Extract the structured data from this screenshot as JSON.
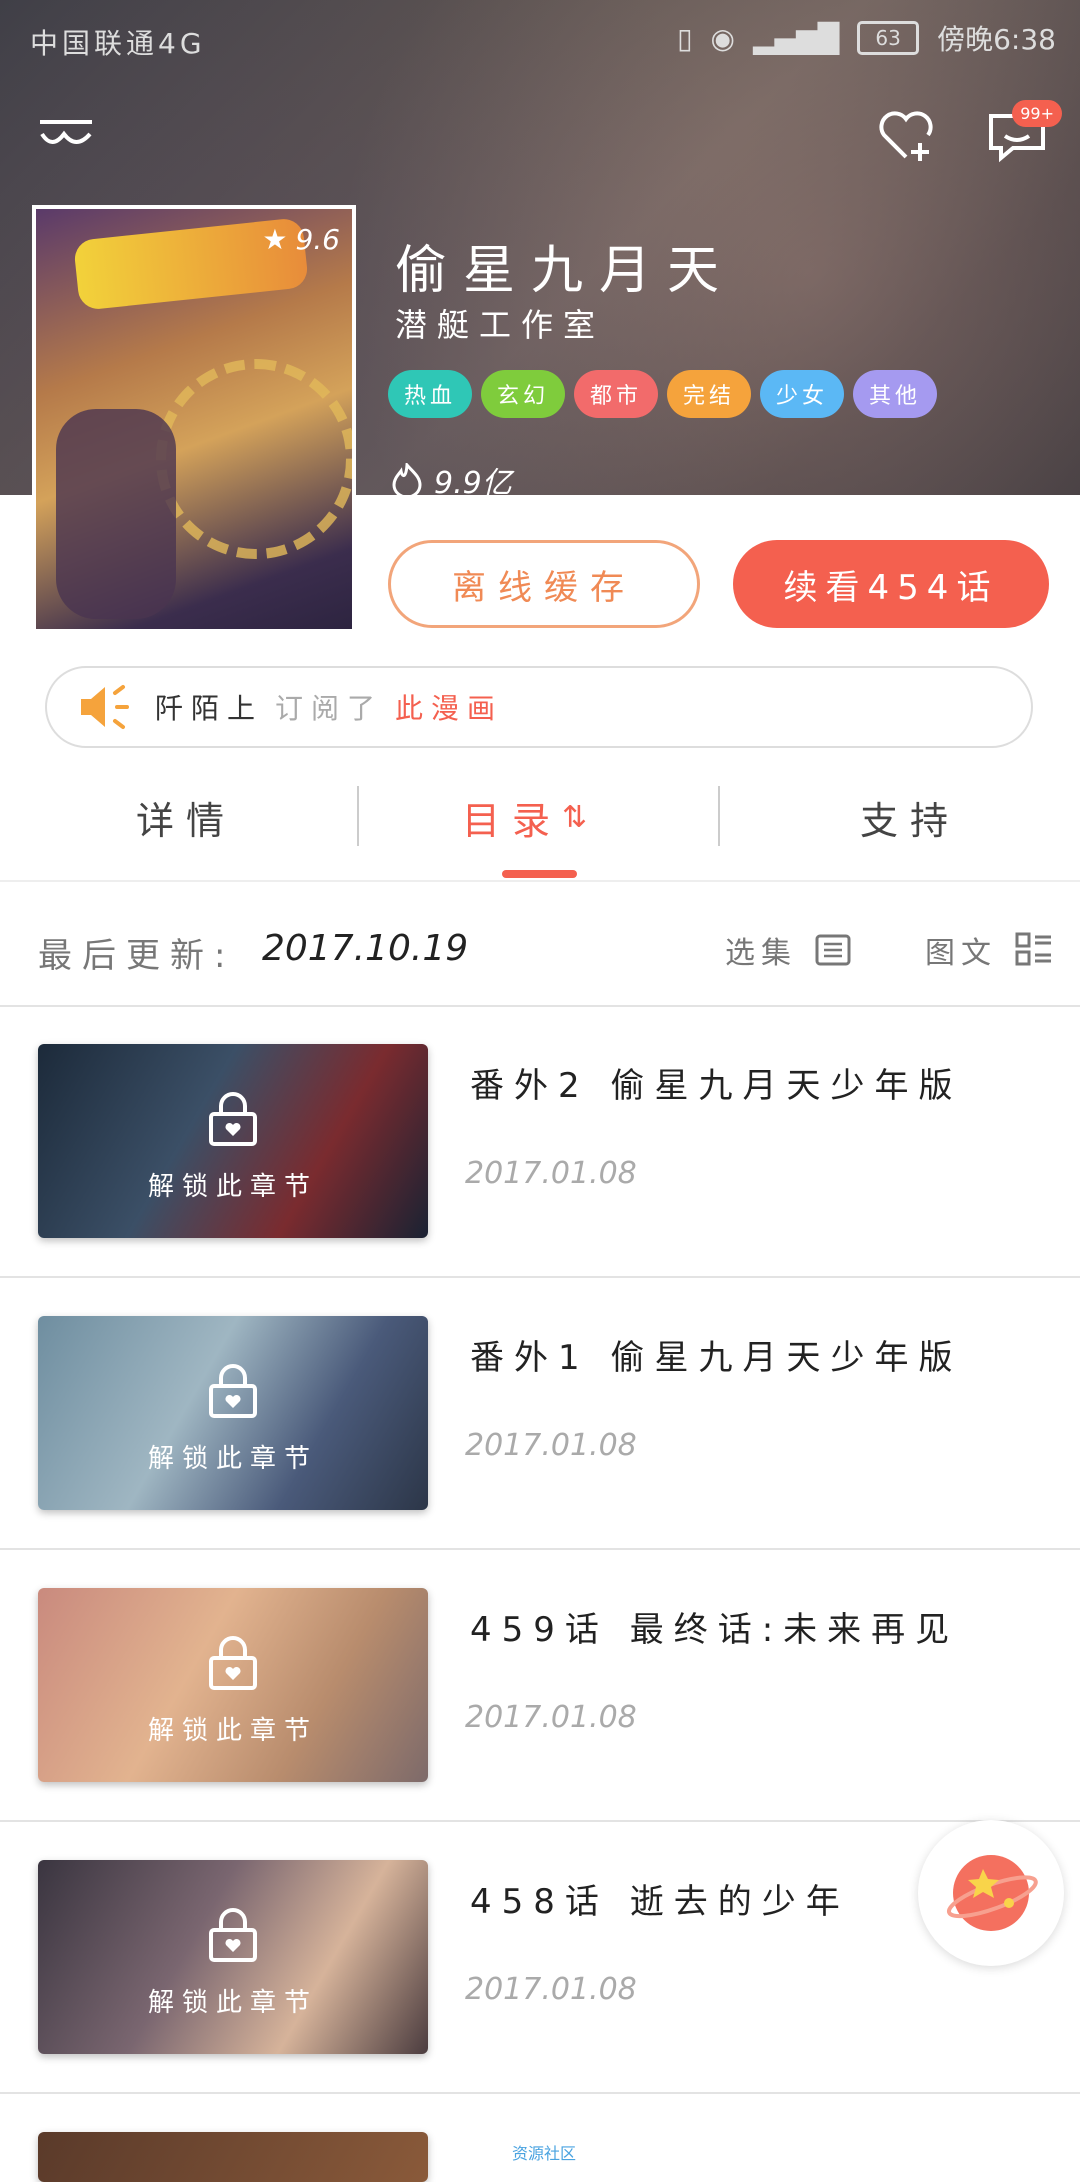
{
  "status": {
    "carrier": "中国联通4G",
    "battery": "63",
    "time": "傍晚6:38"
  },
  "header": {
    "notification_badge": "99+"
  },
  "comic": {
    "title": "偷星九月天",
    "author": "潜艇工作室",
    "rating": "9.6",
    "popularity": "9.9亿",
    "tags": [
      {
        "label": "热血",
        "color": "#2fc7b6"
      },
      {
        "label": "玄幻",
        "color": "#7fcc3c"
      },
      {
        "label": "都市",
        "color": "#f26b6b"
      },
      {
        "label": "完结",
        "color": "#f5a33c"
      },
      {
        "label": "少女",
        "color": "#5bb8f5"
      },
      {
        "label": "其他",
        "color": "#a59af0"
      }
    ]
  },
  "actions": {
    "offline": "离线缓存",
    "continue": "续看454话"
  },
  "subscribe": {
    "prefix": "阡陌上",
    "middle": "订阅了",
    "suffix": "此漫画"
  },
  "tabs": {
    "details": "详情",
    "catalog": "目录",
    "support": "支持"
  },
  "update": {
    "label": "最后更新:",
    "date": "2017.10.19",
    "select": "选集",
    "view": "图文"
  },
  "chapters": [
    {
      "title": "番外2 偷星九月天少年版",
      "date": "2017.01.08",
      "unlock": "解锁此章节",
      "bg": "linear-gradient(120deg,#1c2a3a 0%,#3b4f66 40%,#7a2b2f 70%,#1a2233 100%)"
    },
    {
      "title": "番外1 偷星九月天少年版",
      "date": "2017.01.08",
      "unlock": "解锁此章节",
      "bg": "linear-gradient(120deg,#6f8ea0 0%,#9fb6c2 40%,#4a5a7a 70%,#2c3648 100%)"
    },
    {
      "title": "459话 最终话:未来再见",
      "date": "2017.01.08",
      "unlock": "解锁此章节",
      "bg": "linear-gradient(120deg,#c98a7e 0%,#e2b38f 40%,#b88c6d 70%,#7d6a6a 100%)"
    },
    {
      "title": "458话 逝去的少年",
      "date": "2017.01.08",
      "unlock": "解锁此章节",
      "bg": "linear-gradient(120deg,#3a3540 0%,#7a6670 40%,#d6b39a 70%,#4b3c3f 100%)"
    }
  ],
  "footer": {
    "community": "资源社区"
  }
}
